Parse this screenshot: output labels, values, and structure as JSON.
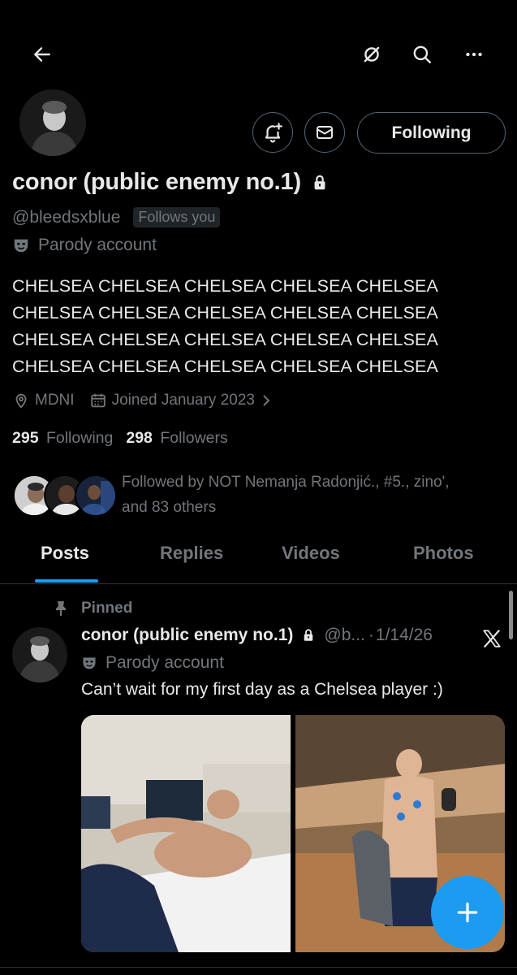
{
  "header": {
    "back_icon": "arrow-left-icon",
    "grok_icon": "slashed-circle-icon",
    "search_icon": "search-icon",
    "more_icon": "more-horizontal-icon"
  },
  "profile": {
    "display_name": "conor (public enemy no.1)",
    "lock_icon": "lock-icon",
    "handle": "@bleedsxblue",
    "follows_you": "Follows you",
    "parody_label": "Parody account",
    "bio_lines": [
      "CHELSEA CHELSEA CHELSEA CHELSEA CHELSEA",
      "CHELSEA CHELSEA CHELSEA CHELSEA CHELSEA",
      "CHELSEA CHELSEA CHELSEA CHELSEA CHELSEA",
      "CHELSEA CHELSEA CHELSEA CHELSEA CHELSEA"
    ],
    "location": "MDNI",
    "joined": "Joined January 2023",
    "following_count": "295",
    "following_label": "Following",
    "followers_count": "298",
    "followers_label": "Followers",
    "followed_by_line1": "Followed by NOT Nemanja Radonjić., #5., zino',",
    "followed_by_line2": "and 83 others"
  },
  "actions": {
    "notify_icon": "bell-plus-icon",
    "message_icon": "envelope-icon",
    "following_button": "Following"
  },
  "tabs": [
    {
      "label": "Posts",
      "active": true
    },
    {
      "label": "Replies",
      "active": false
    },
    {
      "label": "Videos",
      "active": false
    },
    {
      "label": "Photos",
      "active": false
    }
  ],
  "post": {
    "pinned_label": "Pinned",
    "author_name": "conor (public enemy no.1)",
    "author_handle": "@b...",
    "separator": "·",
    "date": "1/14/26",
    "parody_label": "Parody account",
    "text": "Can’t wait for my first day as a Chelsea player :)"
  },
  "fab": {
    "icon": "plus-icon"
  },
  "colors": {
    "background": "#000000",
    "accent": "#1d9bf0",
    "muted": "#71767b",
    "text": "#e7e9ea"
  }
}
